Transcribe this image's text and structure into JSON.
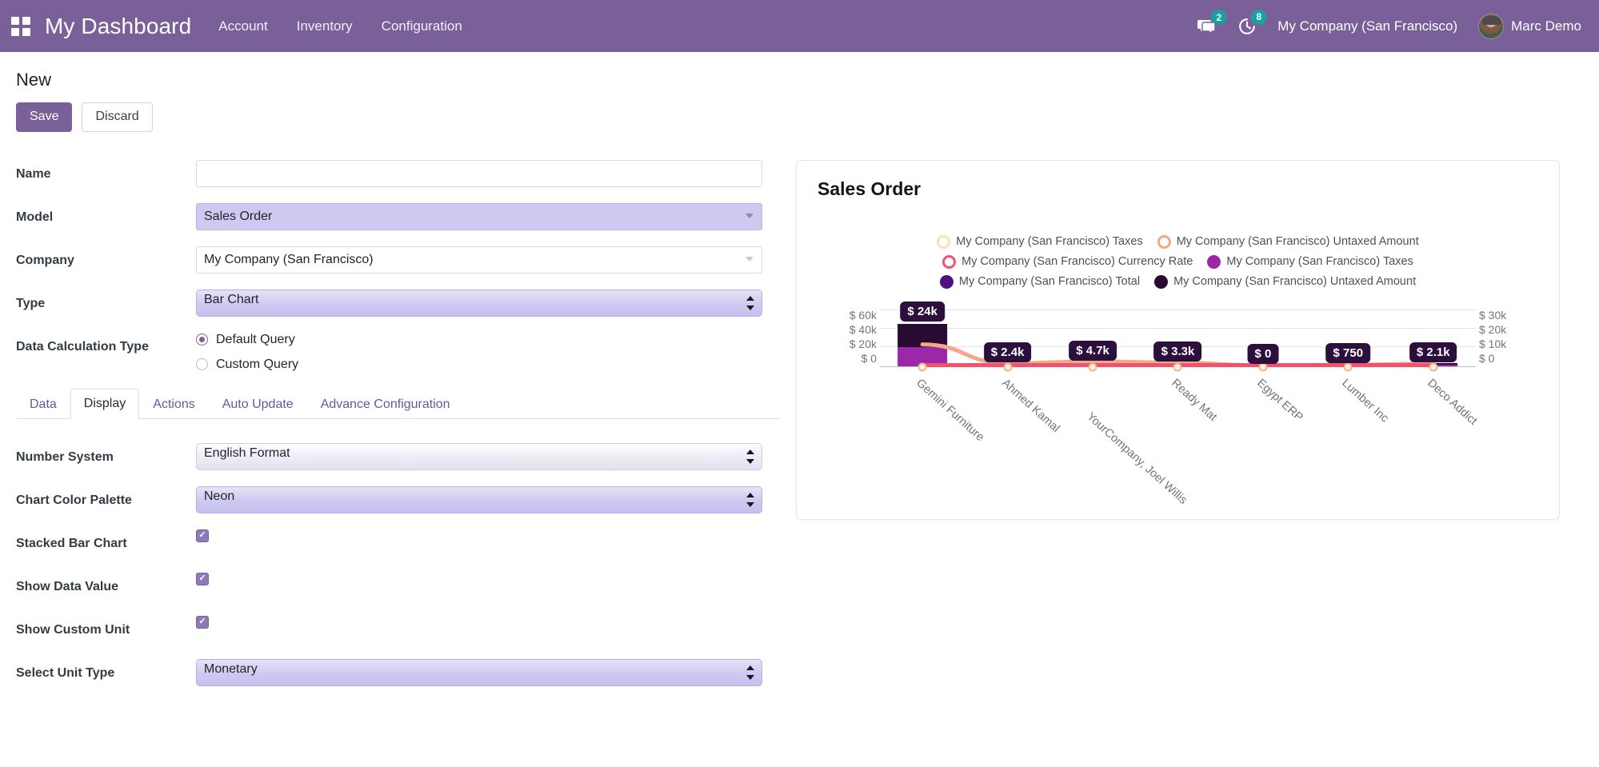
{
  "navbar": {
    "apps_icon": "apps-grid-icon",
    "brand": "My Dashboard",
    "menu": [
      {
        "label": "Account"
      },
      {
        "label": "Inventory"
      },
      {
        "label": "Configuration"
      }
    ],
    "messages_icon": "chat-bubble-icon",
    "messages_count": "2",
    "activities_icon": "clock-icon",
    "activities_count": "8",
    "company": "My Company (San Francisco)",
    "user_name": "Marc Demo",
    "avatar_icon": "user-avatar",
    "brand_color": "#7a6099",
    "badge_color": "#17a2a2"
  },
  "record": {
    "title": "New",
    "save_label": "Save",
    "discard_label": "Discard"
  },
  "form": {
    "name_label": "Name",
    "name_value": "",
    "name_placeholder": "",
    "model_label": "Model",
    "model_value": "Sales Order",
    "company_label": "Company",
    "company_value": "My Company (San Francisco)",
    "type_label": "Type",
    "type_value": "Bar Chart",
    "type_options": [
      "Bar Chart"
    ],
    "data_calc_label": "Data Calculation Type",
    "radio_default": "Default Query",
    "radio_custom": "Custom Query",
    "radio_selected": "Default Query"
  },
  "notebook": {
    "tabs": [
      {
        "label": "Data",
        "active": false
      },
      {
        "label": "Display",
        "active": true
      },
      {
        "label": "Actions",
        "active": false
      },
      {
        "label": "Auto Update",
        "active": false
      },
      {
        "label": "Advance Configuration",
        "active": false
      }
    ]
  },
  "display": {
    "number_system_label": "Number System",
    "number_system_value": "English Format",
    "palette_label": "Chart Color Palette",
    "palette_value": "Neon",
    "stacked_label": "Stacked Bar Chart",
    "stacked_checked": true,
    "data_value_label": "Show Data Value",
    "data_value_checked": true,
    "custom_unit_label": "Show Custom Unit",
    "custom_unit_checked": true,
    "unit_type_label": "Select Unit Type",
    "unit_type_value": "Monetary"
  },
  "chart_data": {
    "type": "bar",
    "title": "Sales Order",
    "xlabel": "",
    "ylabel": "",
    "stacked": true,
    "grid": true,
    "legend_position": "top",
    "categories": [
      "Gemini Furniture",
      "Ahmed Kamal",
      "YourCompany, Joel Willis",
      "Ready Mat",
      "Egypt ERP",
      "Lumber Inc",
      "Deco Addict"
    ],
    "y_left_ticks": [
      "$ 60k",
      "$ 40k",
      "$ 20k",
      "$ 0"
    ],
    "y_left_lim": [
      0,
      60000
    ],
    "y_right_ticks": [
      "$ 30k",
      "$ 20k",
      "$ 10k",
      "$ 0"
    ],
    "y_right_lim": [
      0,
      30000
    ],
    "data_labels": [
      "$ 24k",
      "$ 2.4k",
      "$ 4.7k",
      "$ 3.3k",
      "$ 0",
      "$ 750",
      "$ 2.1k"
    ],
    "series": [
      {
        "name": "My Company (San Francisco) Taxes",
        "kind": "line",
        "marker": "ring",
        "color": "#fae3b0",
        "values": [
          0,
          0,
          0,
          0,
          0,
          0,
          0
        ]
      },
      {
        "name": "My Company (San Francisco) Untaxed Amount",
        "kind": "line",
        "marker": "ring",
        "color": "#f4a88a",
        "values": [
          24000,
          2400,
          4700,
          3300,
          0,
          750,
          2100
        ]
      },
      {
        "name": "My Company (San Francisco) Currency Rate",
        "kind": "line",
        "marker": "ring",
        "color": "#f2526e",
        "values": [
          0,
          0,
          0,
          0,
          0,
          0,
          0
        ]
      },
      {
        "name": "My Company (San Francisco) Taxes",
        "kind": "bar",
        "marker": "dot",
        "color": "#9c27a8",
        "values": [
          20000,
          300,
          900,
          600,
          0,
          150,
          400
        ]
      },
      {
        "name": "My Company (San Francisco) Total",
        "kind": "bar",
        "marker": "dot",
        "color": "#50107e",
        "values": [
          0,
          0,
          0,
          0,
          0,
          0,
          0
        ]
      },
      {
        "name": "My Company (San Francisco) Untaxed Amount",
        "kind": "bar",
        "marker": "dot",
        "color": "#280a33",
        "values": [
          24000,
          1200,
          2200,
          1400,
          0,
          500,
          1100
        ]
      }
    ]
  }
}
